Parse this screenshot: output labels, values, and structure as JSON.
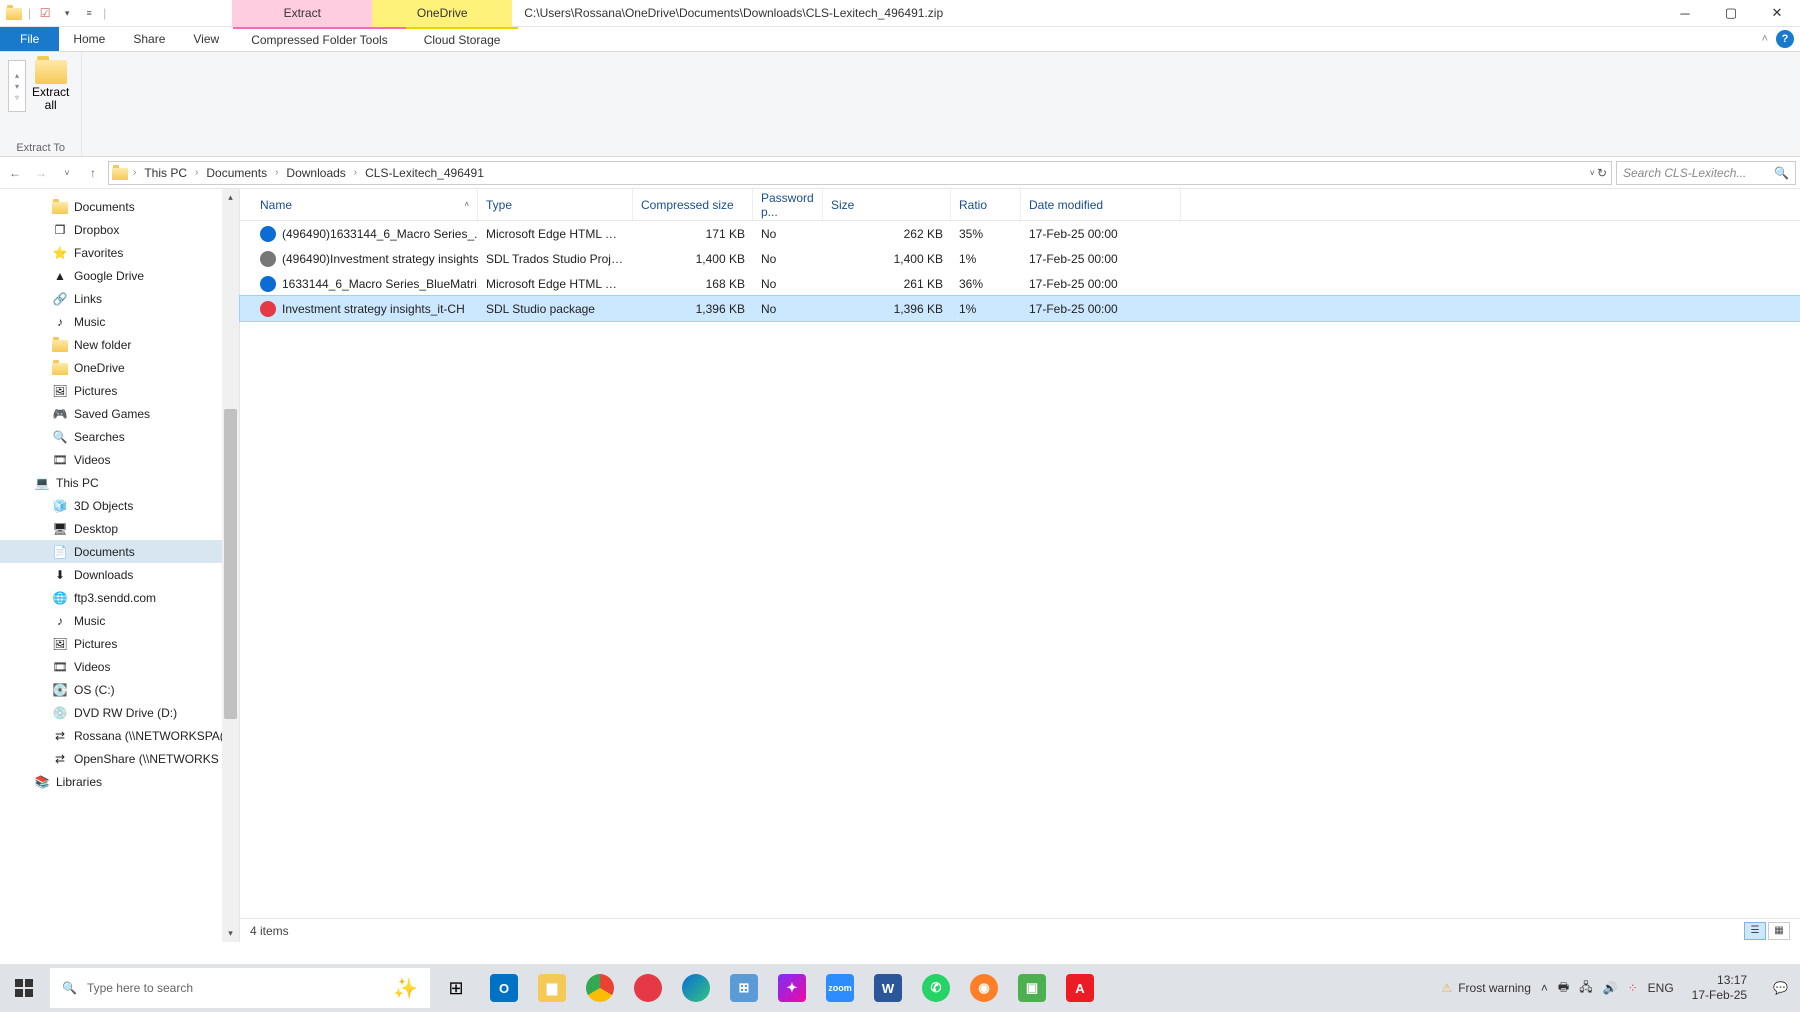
{
  "title_path": "C:\\Users\\Rossana\\OneDrive\\Documents\\Downloads\\CLS-Lexitech_496491.zip",
  "ctx_tabs": {
    "extract": "Extract",
    "onedrive": "OneDrive"
  },
  "tabs": {
    "file": "File",
    "home": "Home",
    "share": "Share",
    "view": "View",
    "cft": "Compressed Folder Tools",
    "cloud": "Cloud Storage"
  },
  "ribbon": {
    "extract_all": "Extract\nall",
    "group": "Extract To"
  },
  "breadcrumbs": [
    "This PC",
    "Documents",
    "Downloads",
    "CLS-Lexitech_496491"
  ],
  "search_placeholder": "Search CLS-Lexitech...",
  "columns": {
    "name": "Name",
    "type": "Type",
    "csize": "Compressed size",
    "pwd": "Password p...",
    "size": "Size",
    "ratio": "Ratio",
    "date": "Date modified"
  },
  "files": [
    {
      "icon": "#0b6dd4",
      "name": "(496490)1633144_6_Macro Series_...",
      "type": "Microsoft Edge HTML Do...",
      "csize": "171 KB",
      "pwd": "No",
      "size": "262 KB",
      "ratio": "35%",
      "date": "17-Feb-25 00:00"
    },
    {
      "icon": "#777",
      "name": "(496490)Investment strategy insights",
      "type": "SDL Trados Studio Project...",
      "csize": "1,400 KB",
      "pwd": "No",
      "size": "1,400 KB",
      "ratio": "1%",
      "date": "17-Feb-25 00:00"
    },
    {
      "icon": "#0b6dd4",
      "name": "1633144_6_Macro Series_BlueMatri...",
      "type": "Microsoft Edge HTML Do...",
      "csize": "168 KB",
      "pwd": "No",
      "size": "261 KB",
      "ratio": "36%",
      "date": "17-Feb-25 00:00"
    },
    {
      "icon": "#e63946",
      "name": "Investment strategy insights_it-CH",
      "type": "SDL Studio package",
      "csize": "1,396 KB",
      "pwd": "No",
      "size": "1,396 KB",
      "ratio": "1%",
      "date": "17-Feb-25 00:00"
    }
  ],
  "selected_row": 3,
  "tree": [
    {
      "label": "Documents",
      "icon": "folder",
      "lvl": 1
    },
    {
      "label": "Dropbox",
      "icon": "dropbox",
      "lvl": 1
    },
    {
      "label": "Favorites",
      "icon": "star",
      "lvl": 1
    },
    {
      "label": "Google Drive",
      "icon": "gdrive",
      "lvl": 1
    },
    {
      "label": "Links",
      "icon": "link",
      "lvl": 1
    },
    {
      "label": "Music",
      "icon": "music",
      "lvl": 1
    },
    {
      "label": "New folder",
      "icon": "folder",
      "lvl": 1
    },
    {
      "label": "OneDrive",
      "icon": "folder",
      "lvl": 1
    },
    {
      "label": "Pictures",
      "icon": "pic",
      "lvl": 1
    },
    {
      "label": "Saved Games",
      "icon": "game",
      "lvl": 1
    },
    {
      "label": "Searches",
      "icon": "search",
      "lvl": 1
    },
    {
      "label": "Videos",
      "icon": "video",
      "lvl": 1
    },
    {
      "label": "This PC",
      "icon": "pc",
      "lvl": 0
    },
    {
      "label": "3D Objects",
      "icon": "3d",
      "lvl": 1
    },
    {
      "label": "Desktop",
      "icon": "desktop",
      "lvl": 1
    },
    {
      "label": "Documents",
      "icon": "doc",
      "lvl": 1,
      "selected": true
    },
    {
      "label": "Downloads",
      "icon": "dl",
      "lvl": 1
    },
    {
      "label": "ftp3.sendd.com",
      "icon": "ftp",
      "lvl": 1
    },
    {
      "label": "Music",
      "icon": "music",
      "lvl": 1
    },
    {
      "label": "Pictures",
      "icon": "pic",
      "lvl": 1
    },
    {
      "label": "Videos",
      "icon": "video",
      "lvl": 1
    },
    {
      "label": "OS (C:)",
      "icon": "drive",
      "lvl": 1
    },
    {
      "label": "DVD RW Drive (D:)",
      "icon": "dvd",
      "lvl": 1
    },
    {
      "label": "Rossana (\\\\NETWORKSPA(",
      "icon": "net",
      "lvl": 1
    },
    {
      "label": "OpenShare (\\\\NETWORKS",
      "icon": "net",
      "lvl": 1
    },
    {
      "label": "Libraries",
      "icon": "lib",
      "lvl": 0
    }
  ],
  "status": "4 items",
  "taskbar": {
    "search_placeholder": "Type here to search",
    "frost": "Frost warning",
    "lang": "ENG",
    "time": "13:17",
    "date": "17-Feb-25"
  }
}
